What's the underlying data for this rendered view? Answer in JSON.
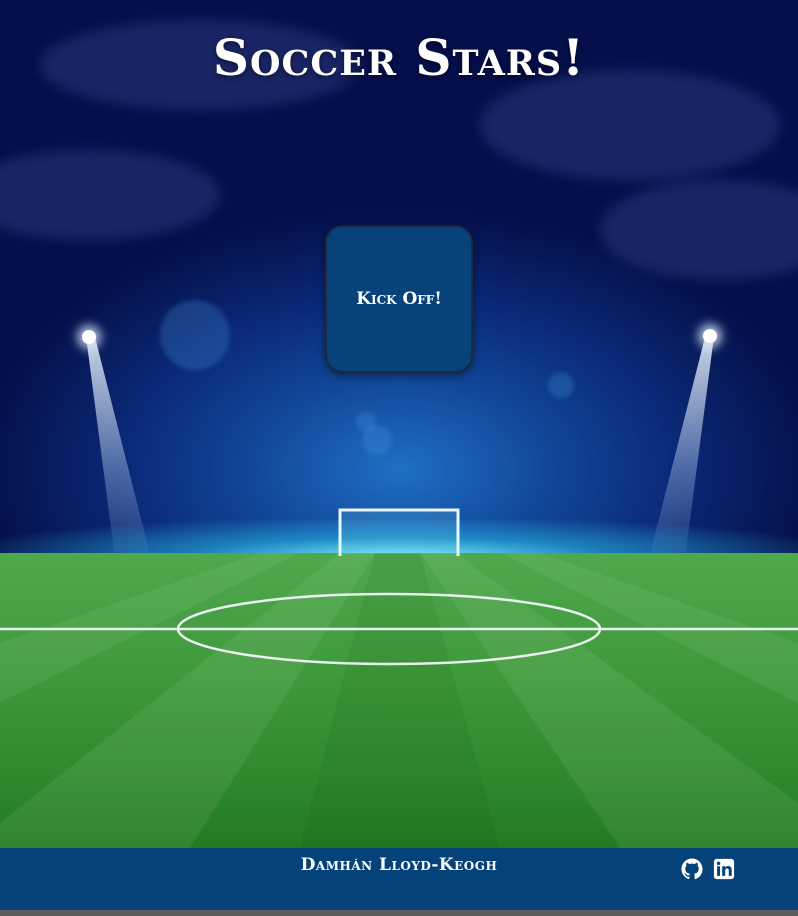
{
  "game": {
    "title": "Soccer Stars!",
    "start_button_label": "Kick Off!"
  },
  "footer": {
    "author": "Damhán Lloyd-Keogh",
    "links": [
      {
        "icon": "github-icon"
      },
      {
        "icon": "linkedin-icon"
      }
    ]
  },
  "colors": {
    "sky_dark": "#050f4a",
    "sky_light": "#1f6fc4",
    "button_bg": "#07427a",
    "footer_bg": "#06427a",
    "pitch_green": "#3f9a3c",
    "line_white": "#e8f0f0"
  }
}
